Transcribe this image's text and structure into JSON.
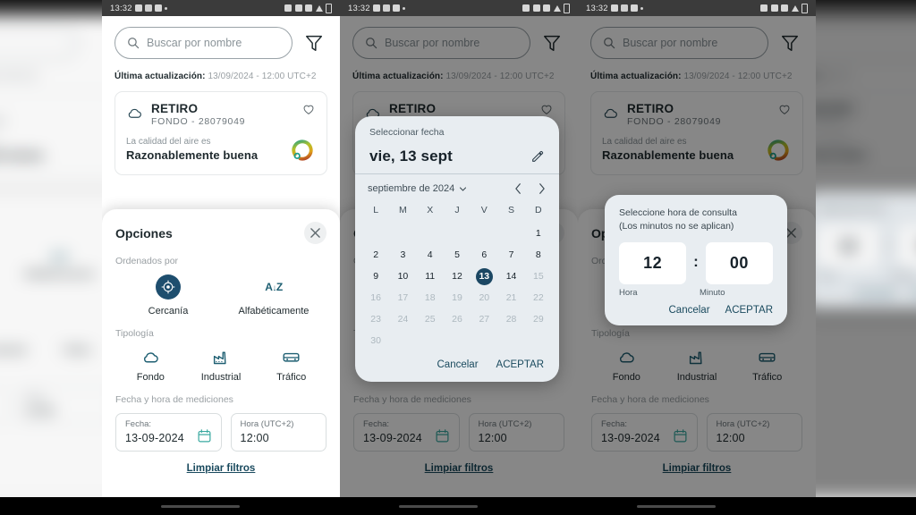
{
  "status_bar": {
    "time": "13:32",
    "icons_left": [
      "calendar-icon",
      "app-icon",
      "play-icon",
      "dot-icon"
    ],
    "icons_right": [
      "cast-icon",
      "bluetooth-icon",
      "wifi-icon",
      "signal-icon",
      "battery-icon"
    ]
  },
  "search": {
    "placeholder": "Buscar por nombre",
    "search_icon": "search-icon",
    "filter_icon": "filter-icon"
  },
  "last_update": {
    "label": "Última actualización:",
    "value": "13/09/2024 - 12:00 UTC+2"
  },
  "station_card": {
    "icon": "cloud-icon",
    "name": "RETIRO",
    "subtitle": "FONDO - 28079049",
    "favorite_icon": "heart-icon",
    "quality_label": "La calidad del aire es",
    "quality_value": "Razonablemente buena",
    "gauge_icon": "aqi-donut-icon"
  },
  "options_sheet": {
    "title": "Opciones",
    "close_icon": "close-icon",
    "sort_label": "Ordenados por",
    "sort_options": [
      {
        "label": "Cercanía",
        "icon": "target-icon",
        "selected": true
      },
      {
        "label": "Alfabéticamente",
        "icon": "az-icon",
        "selected": false
      }
    ],
    "type_label": "Tipología",
    "type_options": [
      {
        "label": "Fondo",
        "icon": "cloud-icon"
      },
      {
        "label": "Industrial",
        "icon": "factory-icon"
      },
      {
        "label": "Tráfico",
        "icon": "car-icon"
      }
    ],
    "datetime_label": "Fecha y hora de mediciones",
    "date_field": {
      "label": "Fecha:",
      "value": "13-09-2024",
      "icon": "calendar-icon"
    },
    "time_field": {
      "label": "Hora (UTC+2)",
      "value": "12:00"
    },
    "clear_link": "Limpiar filtros"
  },
  "date_dialog": {
    "supporting_text": "Seleccionar fecha",
    "headline": "vie, 13 sept",
    "edit_icon": "pencil-icon",
    "month_label": "septiembre de 2024",
    "dropdown_icon": "chevron-down-icon",
    "prev_icon": "chevron-left-icon",
    "next_icon": "chevron-right-icon",
    "weekdays": [
      "L",
      "M",
      "X",
      "J",
      "V",
      "S",
      "D"
    ],
    "weeks": [
      [
        "",
        "",
        "",
        "",
        "",
        "",
        "1"
      ],
      [
        "2",
        "3",
        "4",
        "5",
        "6",
        "7",
        "8"
      ],
      [
        "9",
        "10",
        "11",
        "12",
        "13",
        "14",
        "15"
      ],
      [
        "16",
        "17",
        "18",
        "19",
        "20",
        "21",
        "22"
      ],
      [
        "23",
        "24",
        "25",
        "26",
        "27",
        "28",
        "29"
      ],
      [
        "30",
        "",
        "",
        "",
        "",
        "",
        ""
      ]
    ],
    "selected_day": "13",
    "disabled_from": "15",
    "cancel_label": "Cancelar",
    "accept_label": "ACEPTAR"
  },
  "time_dialog": {
    "title_line1": "Seleccione hora de consulta",
    "title_line2": "(Los minutos no se aplican)",
    "hour_value": "12",
    "minute_value": "00",
    "separator": ":",
    "hour_label": "Hora",
    "minute_label": "Minuto",
    "cancel_label": "Cancelar",
    "accept_label": "ACEPTAR"
  },
  "colors": {
    "accent": "#1a4a5e",
    "selected_day_bg": "#1b4763",
    "sort_selected_bg": "#1e4e6e",
    "icon_teal": "#1e5f72",
    "dialog_bg": "#e8edf1",
    "scrim": "rgba(0,0,0,0.47)"
  }
}
